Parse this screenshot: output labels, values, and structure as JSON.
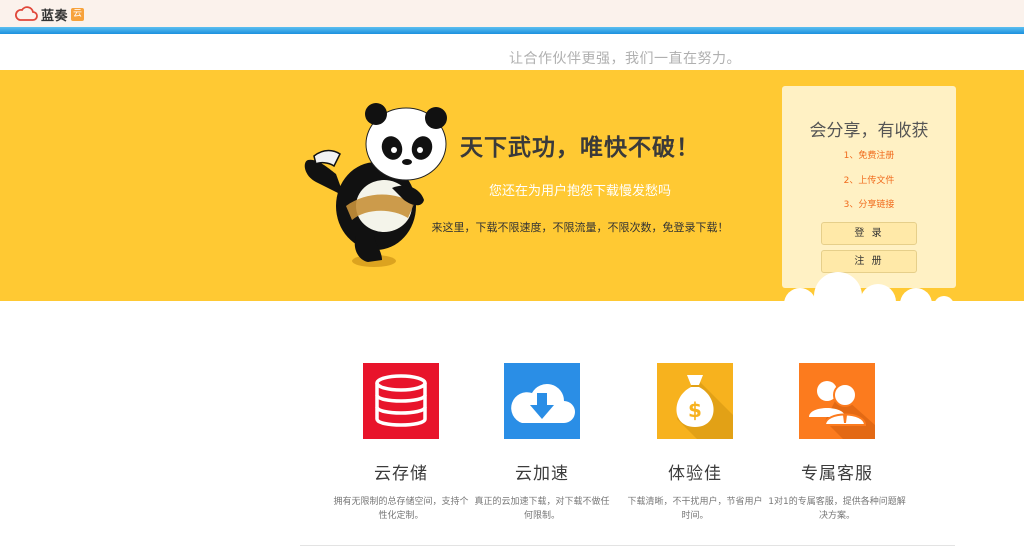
{
  "header": {
    "logo_text": "蓝奏",
    "logo_badge": "云",
    "slogan": "让合作伙伴更强，我们一直在努力。"
  },
  "banner": {
    "title": "天下武功，唯快不破！",
    "subtitle": "您还在为用户抱怨下载慢发愁吗",
    "description": "来这里，下载不限速度，不限流量，不限次数，免登录下载！"
  },
  "card": {
    "title": "会分享，有收获",
    "steps": [
      "1、免费注册",
      "2、上传文件",
      "3、分享链接"
    ],
    "login_label": "登 录",
    "register_label": "注 册"
  },
  "features": [
    {
      "title": "云存储",
      "desc": "拥有无限制的总存储空间，支持个性化定制。",
      "icon": "database-icon",
      "color": "#e8142b"
    },
    {
      "title": "云加速",
      "desc": "真正的云加速下载，对下载不做任何限制。",
      "icon": "cloud-download-icon",
      "color": "#2a8ee6"
    },
    {
      "title": "体验佳",
      "desc": "下载清晰，不干扰用户，节省用户时间。",
      "icon": "money-bag-icon",
      "color": "#f7b21e"
    },
    {
      "title": "专属客服",
      "desc": "1对1的专属客服，提供各种问题解决方案。",
      "icon": "support-users-icon",
      "color": "#fc7b1e"
    }
  ],
  "colors": {
    "banner_bg": "#ffc933",
    "accent_blue": "#1c90de",
    "step_orange": "#f06a1b"
  }
}
